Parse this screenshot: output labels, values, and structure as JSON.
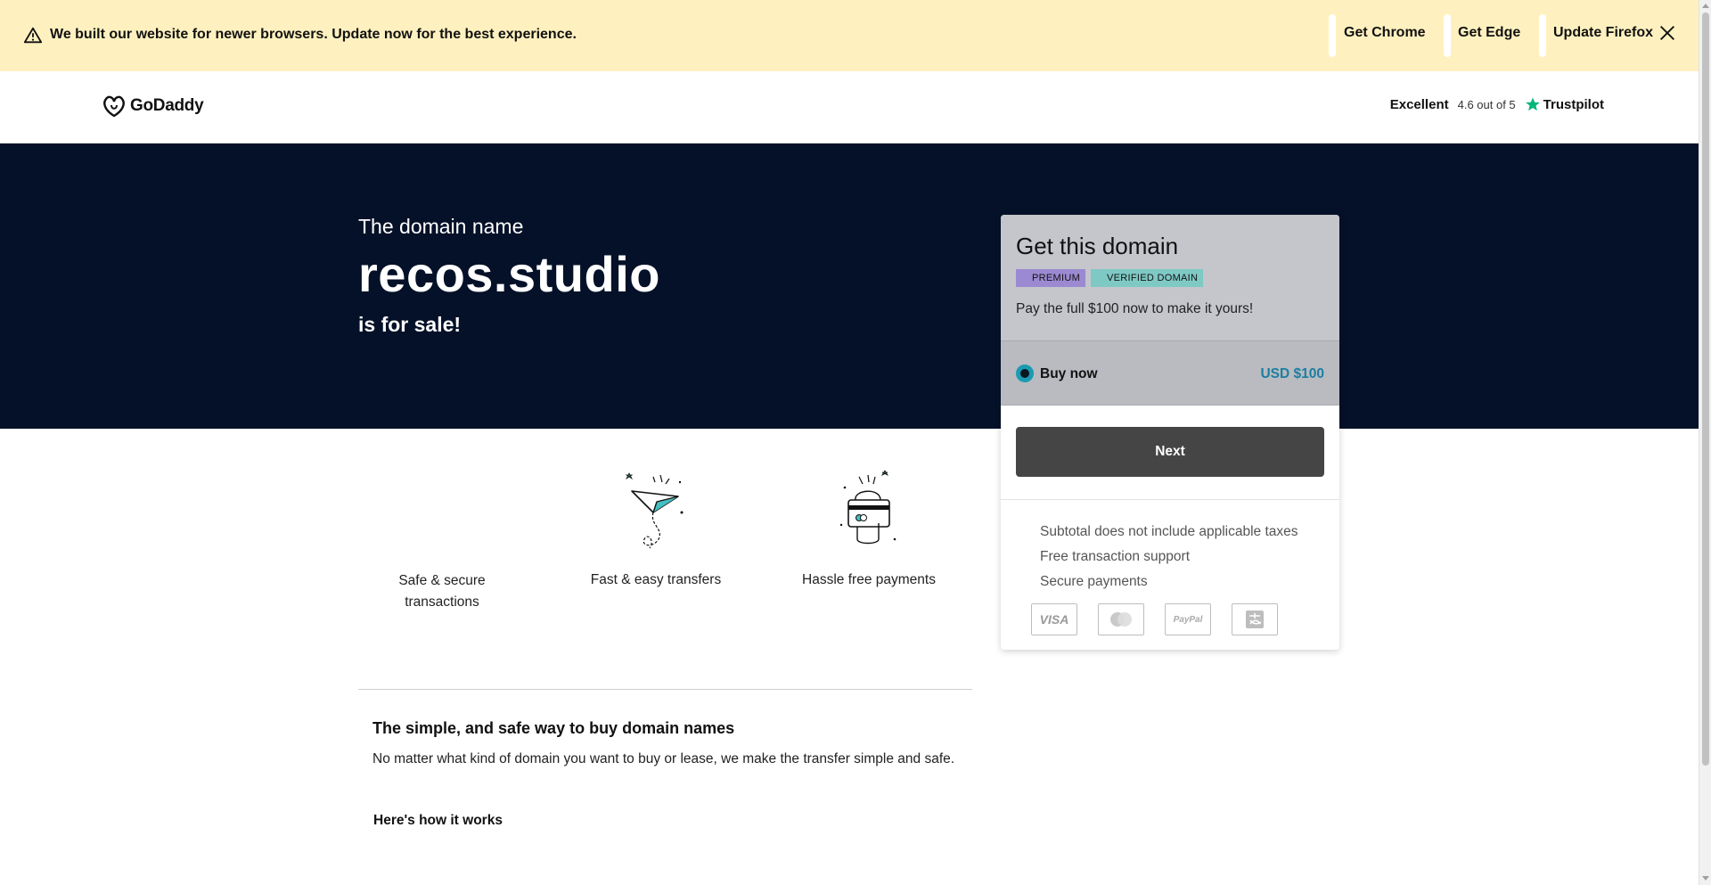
{
  "banner": {
    "message": "We built our website for newer browsers. Update now for the best experience.",
    "links": [
      "Get Chrome",
      "Get Edge",
      "Update Firefox"
    ]
  },
  "header": {
    "logo_text": "GoDaddy",
    "trust_rating_label": "Excellent",
    "trust_score": "4.6 out of 5",
    "trust_brand": "Trustpilot"
  },
  "hero": {
    "pre_text": "The domain name",
    "domain": "recos.studio",
    "post_text": "is for sale!"
  },
  "card": {
    "title": "Get this domain",
    "badges": [
      "PREMIUM",
      "VERIFIED DOMAIN"
    ],
    "description": "Pay the full $100 now to make it yours!",
    "option_label": "Buy now",
    "option_price": "USD $100",
    "next_label": "Next",
    "notes": [
      "Subtotal does not include applicable taxes",
      "Free transaction support",
      "Secure payments"
    ],
    "payment_methods": [
      "VISA",
      "Mastercard",
      "PayPal",
      "Alipay"
    ]
  },
  "features": [
    {
      "label_line1": "Safe & secure",
      "label_line2": "transactions"
    },
    {
      "label_line1": "Fast & easy transfers",
      "label_line2": ""
    },
    {
      "label_line1": "Hassle free payments",
      "label_line2": ""
    }
  ],
  "info": {
    "title": "The simple, and safe way to buy domain names",
    "text": "No matter what kind of domain you want to buy or lease, we make the transfer simple and safe.",
    "how_label": "Here's how it works"
  },
  "colors": {
    "banner_bg": "#fff1bf",
    "hero_bg": "#041128",
    "premium_badge": "#9b8ad1",
    "verified_badge": "#7fc9c5",
    "price_accent": "#1b7fa0",
    "next_button": "#454545"
  }
}
